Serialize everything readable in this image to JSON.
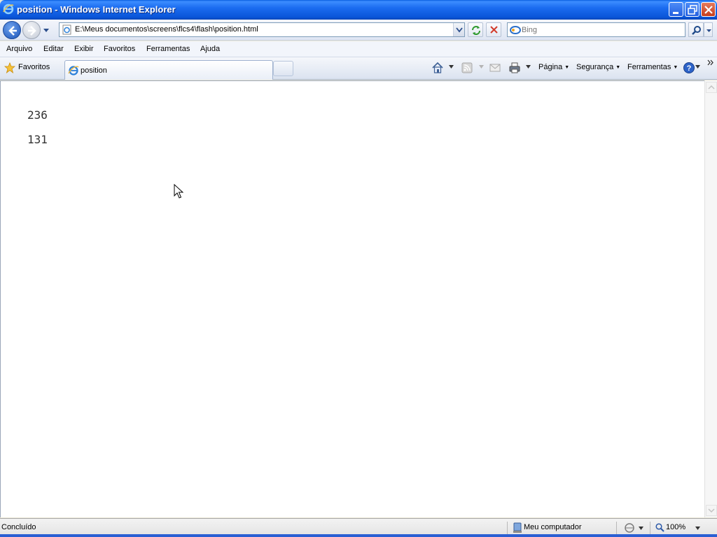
{
  "window": {
    "title": "position - Windows Internet Explorer"
  },
  "address_bar": {
    "url": "E:\\Meus documentos\\screens\\flcs4\\flash\\position.html"
  },
  "search": {
    "placeholder": "Bing"
  },
  "menu": {
    "items": [
      "Arquivo",
      "Editar",
      "Exibir",
      "Favoritos",
      "Ferramentas",
      "Ajuda"
    ]
  },
  "favorites_bar": {
    "favorites_label": "Favoritos",
    "tab_label": "position"
  },
  "command_bar": {
    "page": "Página",
    "security": "Segurança",
    "tools": "Ferramentas"
  },
  "content": {
    "values": [
      "236",
      "131"
    ]
  },
  "status_bar": {
    "status": "Concluído",
    "zone": "Meu computador",
    "zoom": "100%"
  },
  "colors": {
    "titlebar": "#0a55d8",
    "content_bg": "#ffffff"
  },
  "icons": [
    "ie-icon",
    "minimize-icon",
    "restore-icon",
    "close-icon",
    "back-icon",
    "forward-icon",
    "refresh-icon",
    "stop-icon",
    "bing-icon",
    "search-icon",
    "star-icon",
    "home-icon",
    "rss-icon",
    "mail-icon",
    "print-icon",
    "help-icon",
    "computer-icon",
    "zoom-icon",
    "mouse-cursor-icon"
  ]
}
